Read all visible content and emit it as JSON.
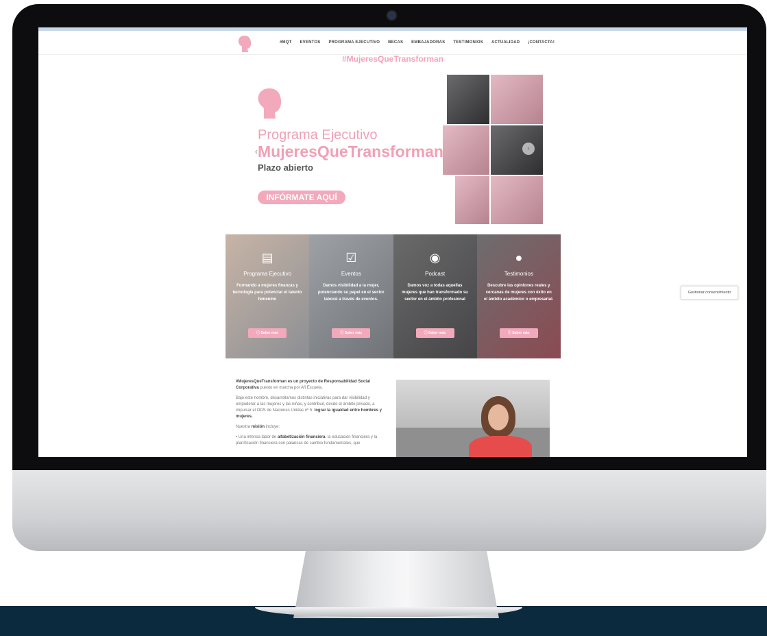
{
  "nav": {
    "items": [
      "#MQT",
      "EVENTOS",
      "PROGRAMA EJECUTIVO",
      "BECAS",
      "EMBAJADORAS",
      "TESTIMONIOS",
      "ACTUALIDAD",
      "¡CONTACTA!"
    ]
  },
  "page": {
    "hashtag_title": "#MujeresQueTransforman"
  },
  "hero": {
    "title": "Programa Ejecutivo",
    "subtitle": "MujeresQueTransforman",
    "tagline": "Plazo abierto",
    "cta": "INFÓRMATE AQUÍ",
    "prev": "‹",
    "next": "›"
  },
  "features": [
    {
      "icon": "book-icon",
      "title": "Programa Ejecutivo",
      "desc": "Formando a mujeres finanzas y tecnología para potenciar el talento femenino",
      "button": "ⓘ Saber más"
    },
    {
      "icon": "calendar-icon",
      "title": "Eventos",
      "desc": "Damos visibilidad a la mujer, potenciando su papel en el sector laboral a través de eventos.",
      "button": "ⓘ Saber más"
    },
    {
      "icon": "podcast-icon",
      "title": "Podcast",
      "desc": "Damos voz a todas aquellas mujeres que han transformado su sector en el ámbito profesional",
      "button": "ⓘ Saber más"
    },
    {
      "icon": "chat-icon",
      "title": "Testimonios",
      "desc": "Descubre las opiniones reales y cercanas de mujeres con éxito en el ámbito académico o empresarial.",
      "button": "ⓘ Saber más"
    }
  ],
  "about": {
    "p1_bold": "#MujeresQueTransforman es un proyecto de Responsabilidad Social Corporativa",
    "p1_rest": " puesto en marcha por Afi Escuela.",
    "p2_a": "Bajo este nombre, desarrollamos distintas iniciativas para dar visibilidad y empoderar a las mujeres y las niñas, y contribuir, desde el ámbito privado, a impulsar el ODS de Naciones Unidas nº 5: ",
    "p2_bold": "lograr la igualdad entre hombres y mujeres.",
    "p3_a": "Nuestra ",
    "p3_bold": "misión",
    "p3_b": " incluye:",
    "li_a": "• Una intensa labor de ",
    "li_bold": "alfabetización financiera",
    "li_b": ": la educación financiera y la planificación financiera son palancas de cambio fundamentales, que"
  },
  "consent": {
    "label": "Gestionar consentimiento"
  }
}
